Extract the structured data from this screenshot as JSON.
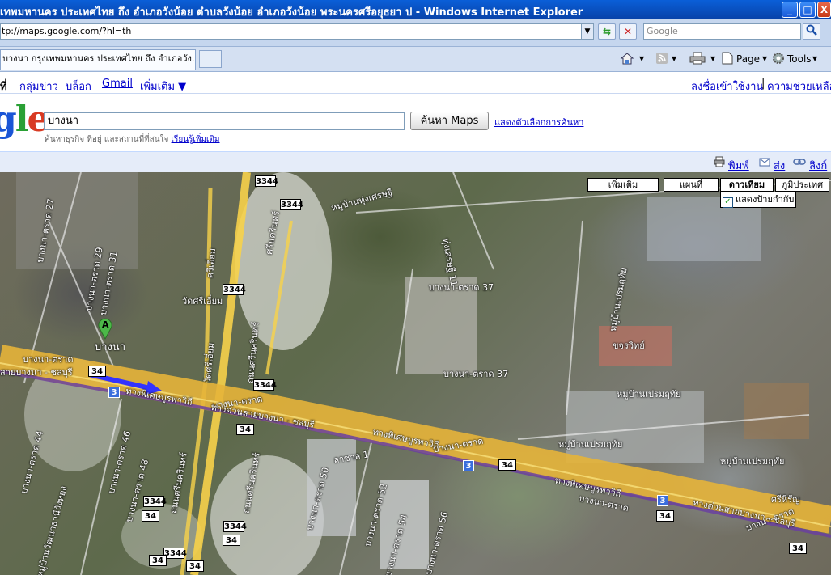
{
  "window": {
    "title": "เทพมหานคร ประเทศไทย ถึง อำเภอวังน้อย ตำบลวังน้อย อำเภอวังน้อย พระนครศรีอยุธยา ป - Windows Internet Explorer",
    "minimize": "_",
    "maximize": "□",
    "close": "X"
  },
  "address": {
    "url": "tp://maps.google.com/?hl=th",
    "search_placeholder": "Google"
  },
  "tabs": [
    {
      "label": "บางนา กรุงเทพมหานคร ประเทศไทย ถึง อำเภอวัง..."
    }
  ],
  "toolbar": {
    "page": "Page",
    "tools": "Tools"
  },
  "gbar": {
    "current": "ที่",
    "links": [
      "กลุ่มข่าว",
      "บล็อก",
      "Gmail",
      "เพิ่มเติม ▼"
    ],
    "signin": "ลงชื่อเข้าใช้งาน",
    "sep": "|",
    "help": "ความช่วยเหลือ"
  },
  "logo": {
    "text": "gle"
  },
  "search": {
    "query": "บางนา",
    "button": "ค้นหา Maps",
    "options": "แสดงตัวเลือกการค้นหา",
    "hint": "ค้นหาธุรกิจ ที่อยู่ และสถานที่ที่สนใจ",
    "learn_more": "เรียนรู้เพิ่มเติม"
  },
  "strip": {
    "print": "พิมพ์",
    "send": "ส่ง",
    "link": "ลิงก์"
  },
  "map_controls": {
    "more": "เพิ่มเติม",
    "map": "แผนที่",
    "satellite": "ดาวเทียม",
    "terrain": "ภูมิประเทศ",
    "show_labels": "แสดงป้ายกำกับ"
  },
  "map_labels": {
    "marker": "A",
    "bangna": "บางนา",
    "bangna_trat": "บางนา-ตราด",
    "bangna_trat_37": "บางนา-ตราด 37",
    "bangna_trat_27": "บางนา-ตราด 27",
    "bangna_trat_29": "บางนา-ตราด 29",
    "bangna_trat_31": "บางนา-ตราด 31",
    "bangna_trat_44": "บางนา-ตราด 44",
    "bangna_trat_46": "บางนา-ตราด 46",
    "bangna_trat_48": "บางนา-ตราด 48",
    "bangna_trat_50": "บางนา-ตราด 50",
    "bangna_trat_52": "บางนา-ตราด 52",
    "bangna_trat_54": "บางนา-ตราด 54",
    "bangna_trat_56": "บางนา-ตราด 56",
    "expressway_bangna_chonburi": "ทางด่วนสายบางนา - ชลบุรี",
    "expressway_short": "สายบางนา - ชลบุรี",
    "phiset_burapha": "ทางพิเศษบูรพาวิถี",
    "srinakarin": "ถนนศรีนครินทร์",
    "srinakarin_short": "ศรีนครินทร์",
    "wat_si_iam": "วัดศรีเอี่ยม",
    "wat_si_iam_road": "วัดศรีเอี่ยม",
    "si_iam": "ศรีเอี่ยม",
    "village_kheha": "หมู่บ้านเคหะชุมชนร่มเกล้า",
    "village_premruthai": "หมู่บ้านเปรมฤทัย",
    "village_premruthai2": "หมู่บ้านเปรมฤทัย",
    "village_premruthai3": "หมู่บ้านเปรมฤทัย",
    "village_premruthai_v": "หมู่บ้านเปรมฤทัย",
    "khlongsong": "ขจรวิทย์",
    "lasalle1": "ลาซาล 1",
    "sriharat": "ศรีหิรัญ",
    "village_tokthai": "หมู่บ้านทุ่งเศรษฐี",
    "thungsetthi11": "ทุ่งเศรษฐี 11",
    "srinakarin_v": "ถนนศรีนครินทร์",
    "village_bottom": "หมู่บ้านวัฒนาธานีวังทอง"
  },
  "shields": {
    "r3344": "3344",
    "r34": "34",
    "r3": "3"
  }
}
